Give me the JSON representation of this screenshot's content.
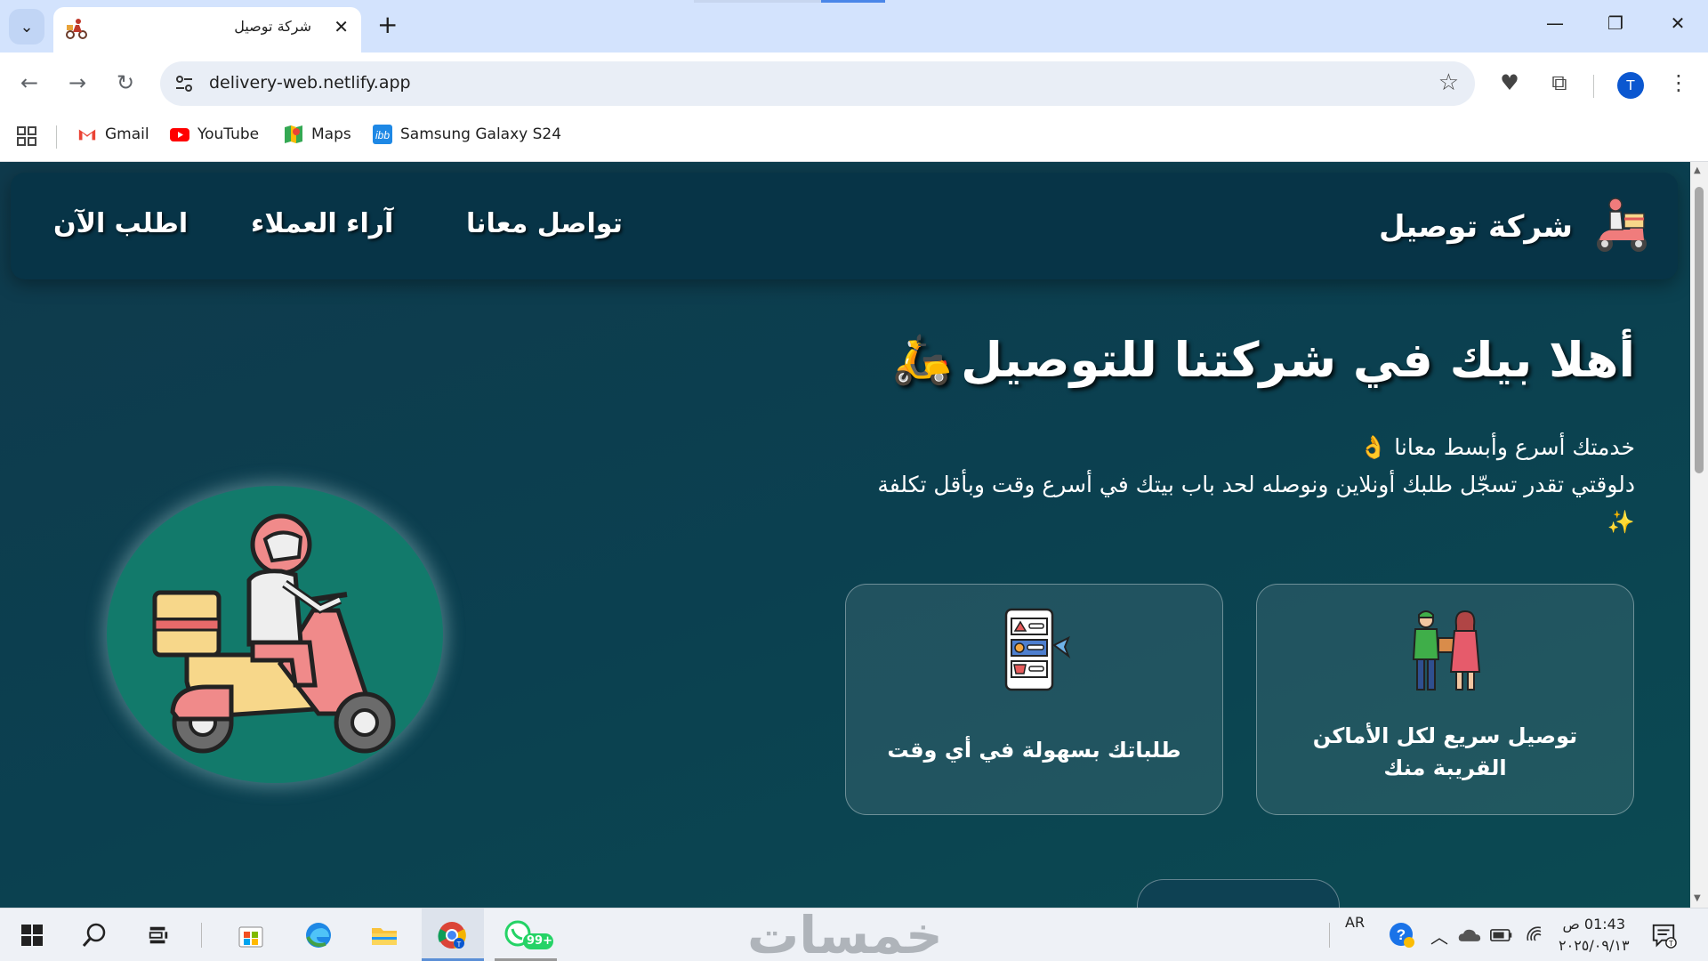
{
  "browser": {
    "tab": {
      "title": "شركة توصيل"
    },
    "address": {
      "url": "delivery-web.netlify.app"
    },
    "profile_initial": "T",
    "bookmarks": [
      {
        "label": "Gmail",
        "icon": "gmail-icon"
      },
      {
        "label": "YouTube",
        "icon": "youtube-icon"
      },
      {
        "label": "Maps",
        "icon": "maps-icon"
      },
      {
        "label": "Samsung Galaxy S24",
        "icon": "ibb-icon"
      }
    ]
  },
  "site": {
    "brand": "شركة توصيل",
    "nav": {
      "contact": "تواصل معانا",
      "reviews": "آراء العملاء",
      "order_now": "اطلب الآن"
    },
    "hero": {
      "title": "أهلا بيك في شركتنا للتوصيل",
      "title_emoji": "🛵",
      "line1": "خدمتك أسرع وأبسط معانا 👌",
      "line2": "دلوقتي تقدر تسجّل طلبك أونلاين ونوصله لحد باب بيتك في أسرع وقت وبأقل تكلفة ✨"
    },
    "cards": [
      {
        "text": "توصيل سريع لكل الأماكن القريبة منك",
        "icon": "delivery-handover-icon"
      },
      {
        "text": "طلباتك بسهولة في أي وقت",
        "icon": "online-order-icon"
      }
    ],
    "colors": {
      "navbar": "#073447",
      "circle": "#127a6b"
    }
  },
  "taskbar": {
    "watermark": "خمسات",
    "language": "AR",
    "time": "01:43 ص",
    "date": "٢٠٢٥/٠٩/١٣",
    "whatsapp_badge": "99+"
  }
}
